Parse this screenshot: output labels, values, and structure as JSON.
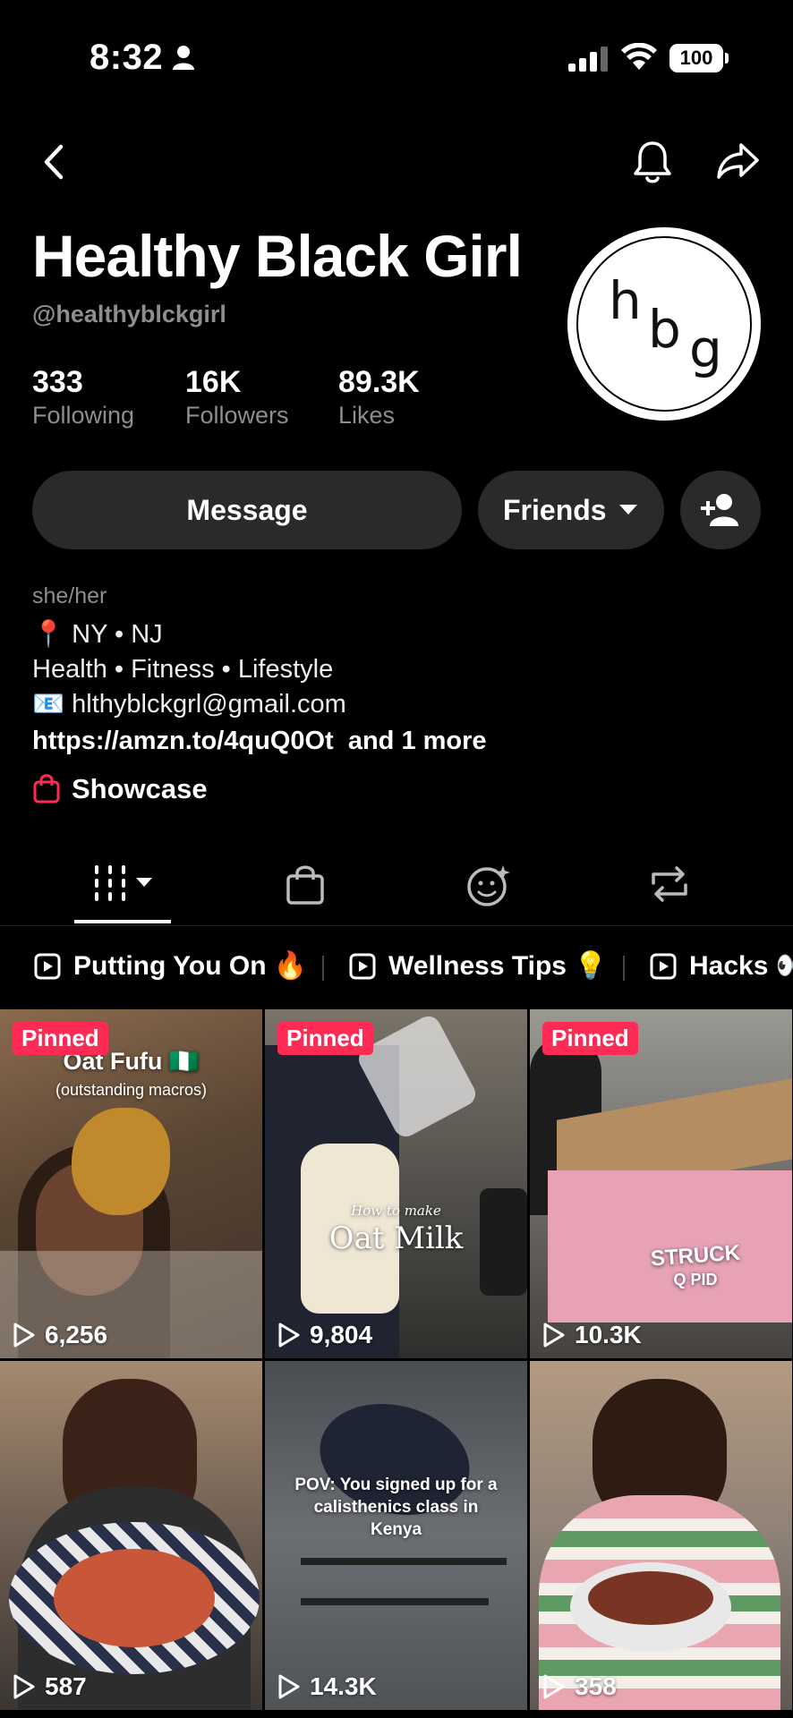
{
  "status_bar": {
    "time": "8:32",
    "battery": "100"
  },
  "profile": {
    "name": "Healthy Black Girl",
    "handle": "@healthyblckgirl",
    "avatar_letters": [
      "h",
      "b",
      "g"
    ],
    "stats": [
      {
        "value": "333",
        "label": "Following"
      },
      {
        "value": "16K",
        "label": "Followers"
      },
      {
        "value": "89.3K",
        "label": "Likes"
      }
    ]
  },
  "actions": {
    "message": "Message",
    "friends": "Friends"
  },
  "bio": {
    "pronouns": "she/her",
    "lines": [
      "📍 NY • NJ",
      "Health • Fitness • Lifestyle",
      "📧 hlthyblckgrl@gmail.com"
    ],
    "link": "https://amzn.to/4quQ0Ot",
    "link_more": "and 1 more",
    "showcase": "Showcase"
  },
  "playlists": [
    {
      "label": "Putting You On 🔥"
    },
    {
      "label": "Wellness Tips 💡"
    },
    {
      "label": "Hacks 👀"
    }
  ],
  "videos": [
    {
      "pinned": "Pinned",
      "views": "6,256",
      "title": "Oat Fufu 🇳🇬",
      "subtitle": "(outstanding macros)"
    },
    {
      "pinned": "Pinned",
      "views": "9,804",
      "title": "Oat Milk",
      "subtitle": "How to make"
    },
    {
      "pinned": "Pinned",
      "views": "10.3K",
      "title": "STRUCK",
      "subtitle": "Q PID"
    },
    {
      "views": "587"
    },
    {
      "views": "14.3K",
      "title": "POV: You signed up for a calisthenics class in Kenya"
    },
    {
      "views": "358"
    }
  ],
  "colors": {
    "accent": "#fe2c55",
    "button_bg": "#2a2a2a",
    "muted_text": "#8e8e8e"
  }
}
